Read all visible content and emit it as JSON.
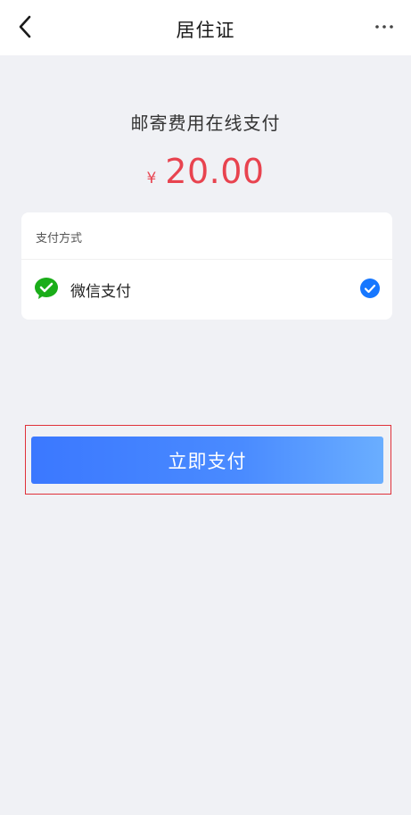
{
  "header": {
    "title": "居住证",
    "back_icon": "chevron-left-icon",
    "more_icon": "more-horizontal-icon"
  },
  "payment": {
    "title": "邮寄费用在线支付",
    "currency_symbol": "¥",
    "amount": "20.00"
  },
  "method_card": {
    "label": "支付方式",
    "methods": [
      {
        "label": "微信支付",
        "icon": "wechat-pay-icon",
        "selected": true
      }
    ]
  },
  "action": {
    "pay_label": "立即支付"
  },
  "colors": {
    "accent_red": "#e8434f",
    "button_blue": "#3b78ff",
    "wechat_green": "#1aad19",
    "check_blue": "#1677ff",
    "highlight_frame": "#e0323a"
  }
}
